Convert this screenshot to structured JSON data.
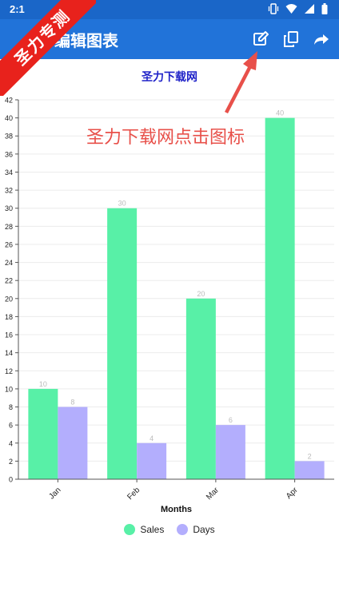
{
  "status_bar": {
    "time": "2:1",
    "icons": [
      "vibrate-icon",
      "wifi-icon",
      "signal-icon",
      "battery-icon"
    ]
  },
  "app_bar": {
    "title": "编辑图表",
    "actions": [
      "edit-icon",
      "copy-icon",
      "share-icon"
    ]
  },
  "watermark": {
    "ribbon_text": "圣力专测",
    "overlay_text": "圣力下载网点击图标"
  },
  "chart_data": {
    "type": "bar",
    "title": "圣力下载网",
    "xlabel": "Months",
    "ylabel": "",
    "categories": [
      "Jan",
      "Feb",
      "Mar",
      "Apr"
    ],
    "series": [
      {
        "name": "Sales",
        "values": [
          10,
          30,
          20,
          40
        ],
        "color": "#58f0a7"
      },
      {
        "name": "Days",
        "values": [
          8,
          4,
          6,
          2
        ],
        "color": "#b3aefd"
      }
    ],
    "ylim": [
      0,
      42
    ],
    "yticks": [
      0,
      2,
      4,
      6,
      8,
      10,
      12,
      14,
      16,
      18,
      20,
      22,
      24,
      26,
      28,
      30,
      32,
      34,
      36,
      38,
      40,
      42
    ],
    "grid": true,
    "legend_position": "bottom"
  }
}
